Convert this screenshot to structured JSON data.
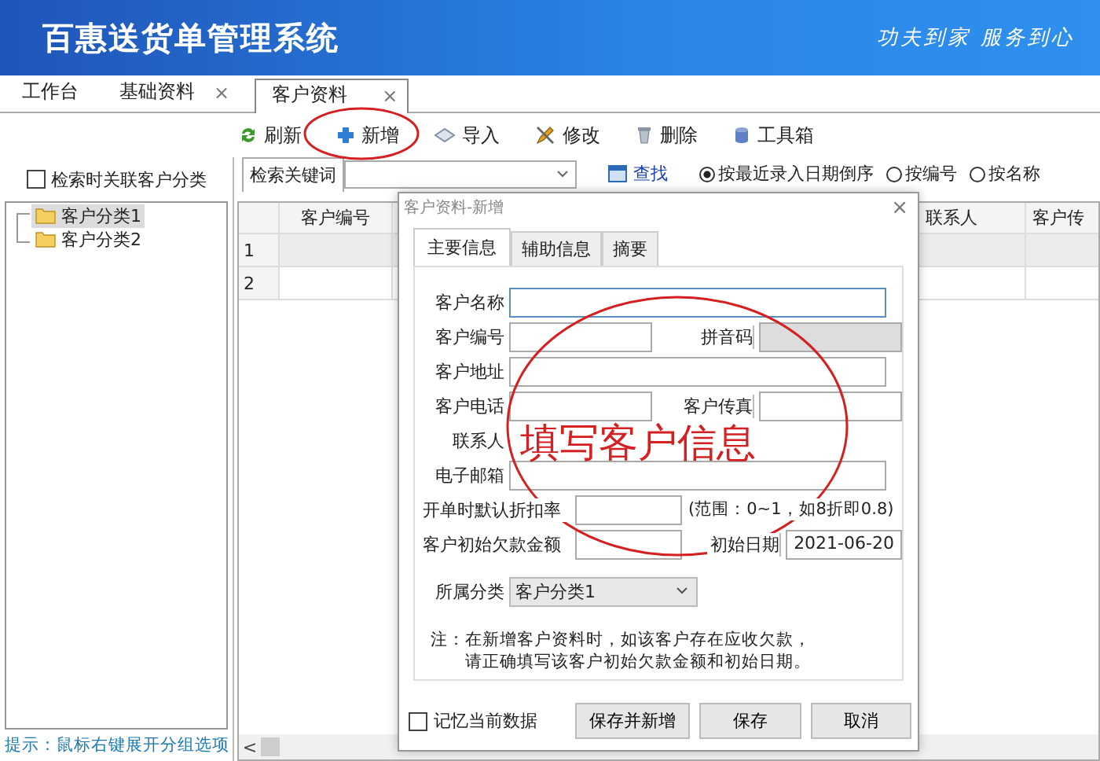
{
  "header": {
    "title": "百惠送货单管理系统",
    "slogan": "功夫到家 服务到心"
  },
  "tabs": [
    {
      "label": "工作台",
      "selected": false,
      "closable": false
    },
    {
      "label": "基础资料",
      "selected": false,
      "closable": true
    },
    {
      "label": "客户资料",
      "selected": true,
      "closable": true
    }
  ],
  "tab_close": "×",
  "toolbar": [
    {
      "label": "刷新",
      "kind": "refresh"
    },
    {
      "label": "新增",
      "kind": "add"
    },
    {
      "label": "导入",
      "kind": "import"
    },
    {
      "label": "修改",
      "kind": "edit"
    },
    {
      "label": "删除",
      "kind": "delete"
    },
    {
      "label": "工具箱",
      "kind": "toolbox"
    }
  ],
  "sidebar": {
    "filter": {
      "label": "检索时关联客户分类",
      "checked": false
    },
    "tree": [
      {
        "label": "客户分类1",
        "selected": true
      },
      {
        "label": "客户分类2",
        "selected": false
      }
    ],
    "hint": "提示：鼠标右键展开分组选项"
  },
  "search": {
    "label": "检索关键词",
    "button": "查找",
    "sort_options": [
      {
        "label": "按最近录入日期倒序",
        "selected": true
      },
      {
        "label": "按编号",
        "selected": false
      },
      {
        "label": "按名称",
        "selected": false
      }
    ]
  },
  "table": {
    "columns": [
      "客户编号",
      "联系人",
      "客户传"
    ],
    "rows": [
      {
        "number": "1",
        "selected": true
      },
      {
        "number": "2",
        "selected": false
      }
    ],
    "scroll_left": "<"
  },
  "dialog": {
    "title": "客户资料-新增",
    "close": "×",
    "tabs": [
      {
        "label": "主要信息",
        "selected": true
      },
      {
        "label": "辅助信息",
        "selected": false
      },
      {
        "label": "摘要",
        "selected": false
      }
    ],
    "rows": [
      {
        "items": [
          {
            "kind": "label",
            "text": "客户名称"
          },
          {
            "kind": "field",
            "focused": true
          }
        ]
      },
      {
        "items": [
          {
            "kind": "label",
            "text": "客户编号"
          },
          {
            "kind": "half-field"
          },
          {
            "kind": "side-label",
            "text": "拼音码"
          },
          {
            "kind": "half-field",
            "disabled": true
          }
        ]
      },
      {
        "items": [
          {
            "kind": "label",
            "text": "客户地址"
          },
          {
            "kind": "field"
          }
        ]
      },
      {
        "items": [
          {
            "kind": "label",
            "text": "客户电话"
          },
          {
            "kind": "half-field"
          },
          {
            "kind": "side-label",
            "text": "客户传真"
          },
          {
            "kind": "half-field"
          }
        ]
      },
      {
        "items": [
          {
            "kind": "label",
            "text": "联系人"
          }
        ]
      },
      {
        "items": [
          {
            "kind": "label",
            "text": "电子邮箱"
          },
          {
            "kind": "field"
          }
        ]
      },
      {
        "items": [
          {
            "kind": "long-label",
            "text": "开单时默认折扣率"
          },
          {
            "kind": "half-field"
          },
          {
            "kind": "hint",
            "text": "(范围：0~1，如8折即0.8)"
          }
        ]
      },
      {
        "items": [
          {
            "kind": "long-label",
            "text": "客户初始欠款金额"
          },
          {
            "kind": "half-field"
          },
          {
            "kind": "side-label",
            "text": "初始日期"
          },
          {
            "kind": "half-field",
            "value": "2021-06-20"
          }
        ]
      }
    ],
    "category": {
      "label": "所属分类",
      "value": "客户分类1"
    },
    "note": [
      "注：在新增客户资料时，如该客户存在应收欠款，",
      "请正确填写该客户初始欠款金额和初始日期。"
    ],
    "remember": {
      "label": "记忆当前数据",
      "checked": false
    },
    "buttons": [
      "保存并新增",
      "保存",
      "取消"
    ]
  },
  "annotation": {
    "text": "填写客户信息"
  }
}
